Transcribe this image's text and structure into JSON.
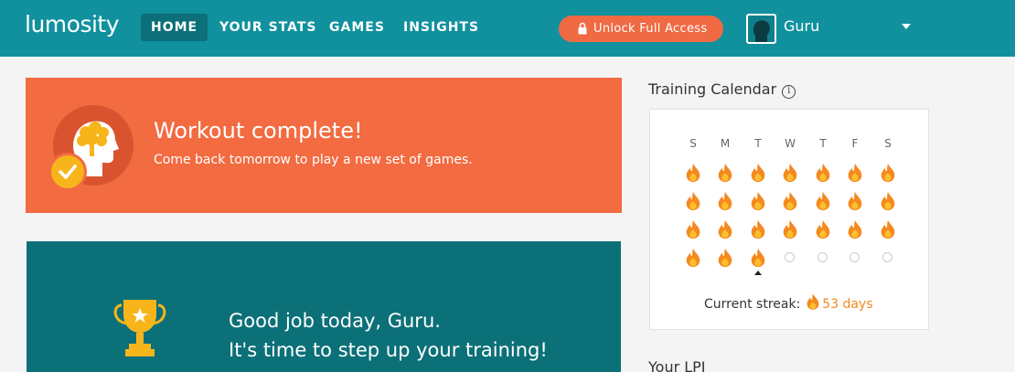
{
  "nav": {
    "logo": "lumosity",
    "items": [
      {
        "label": "HOME"
      },
      {
        "label": "YOUR STATS"
      },
      {
        "label": "GAMES"
      },
      {
        "label": "INSIGHTS"
      }
    ],
    "unlock_label": "Unlock Full Access",
    "username": "Guru"
  },
  "workout": {
    "title": "Workout complete!",
    "subtitle": "Come back tomorrow to play a new set of games."
  },
  "training": {
    "line1": "Good job today, Guru.",
    "line2": "It's time to step up your training!"
  },
  "calendar": {
    "title": "Training Calendar",
    "info_symbol": "i",
    "days": [
      "S",
      "M",
      "T",
      "W",
      "T",
      "F",
      "S"
    ],
    "weeks": [
      [
        true,
        true,
        true,
        true,
        true,
        true,
        true
      ],
      [
        true,
        true,
        true,
        true,
        true,
        true,
        true
      ],
      [
        true,
        true,
        true,
        true,
        true,
        true,
        true
      ],
      [
        true,
        true,
        true,
        false,
        false,
        false,
        false
      ]
    ],
    "today_index": 2,
    "streak_label": "Current streak:",
    "streak_value": "53 days"
  },
  "lpi": {
    "title": "Your LPI"
  },
  "colors": {
    "nav_bg": "#11919e",
    "accent_orange": "#f26b41",
    "flame": "#f5891f",
    "teal_dark": "#0c7078"
  },
  "icons": [
    "lock-icon",
    "brain-head-icon",
    "check-icon",
    "trophy-icon",
    "flame-icon",
    "info-icon",
    "chevron-down-icon"
  ]
}
